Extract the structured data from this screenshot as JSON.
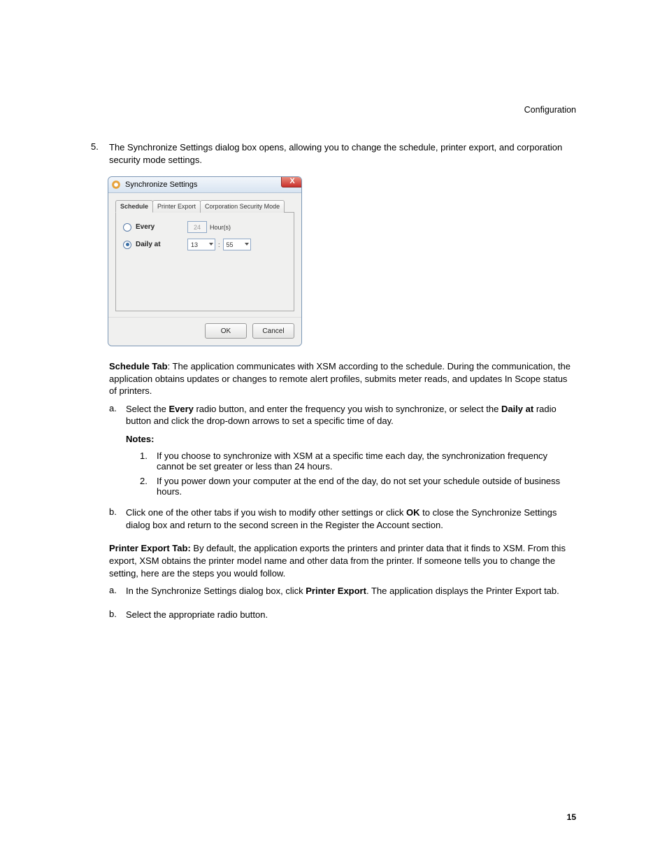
{
  "header": {
    "section_title": "Configuration"
  },
  "main": {
    "step_number": "5.",
    "step_text": "The Synchronize Settings dialog box opens, allowing you to change the schedule, printer export, and corporation security mode settings."
  },
  "dialog": {
    "title": "Synchronize Settings",
    "close_glyph": "X",
    "tabs": {
      "schedule": "Schedule",
      "printer_export": "Printer Export",
      "csm": "Corporation Security Mode"
    },
    "every_label": "Every",
    "every_value": "24",
    "every_unit": "Hour(s)",
    "daily_label": "Daily at",
    "daily_hour": "13",
    "daily_sep": ":",
    "daily_min": "55",
    "ok": "OK",
    "cancel": "Cancel"
  },
  "schedule_tab": {
    "label": "Schedule Tab",
    "desc": ": The application communicates with XSM according to the schedule. During the communication, the application obtains updates or changes to remote alert profiles, submits meter reads, and updates In Scope status of printers.",
    "a_marker": "a.",
    "a_pre": "Select the ",
    "a_bold1": "Every",
    "a_mid": " radio button, and enter the frequency you wish to synchronize, or select the ",
    "a_bold2": "Daily at",
    "a_post": " radio button and click the drop-down arrows to set a specific time of day.",
    "notes_label": "Notes:",
    "n1_marker": "1.",
    "n1_text": "If you choose to synchronize with XSM at a specific time each day, the synchronization frequency cannot be set greater or less than 24 hours.",
    "n2_marker": "2.",
    "n2_text": "If you power down your computer at the end of the day, do not set your schedule outside of business hours.",
    "b_marker": "b.",
    "b_pre": "Click one of the other tabs if you wish to modify other settings or click ",
    "b_bold": "OK",
    "b_post": " to close the Synchronize Settings dialog box and return to the second screen in the Register the Account section."
  },
  "printer_tab": {
    "label": "Printer Export Tab:",
    "desc": " By default, the application exports the printers and printer data that it finds to XSM. From this export, XSM obtains the printer model name and other data from the printer. If someone tells you to change the setting, here are the steps you would follow.",
    "a_marker": "a.",
    "a_pre": "In the Synchronize Settings dialog box, click ",
    "a_bold": "Printer Export",
    "a_post": ". The application displays the Printer Export tab.",
    "b_marker": "b.",
    "b_text": "Select the appropriate radio button."
  },
  "footer": {
    "page_number": "15"
  }
}
